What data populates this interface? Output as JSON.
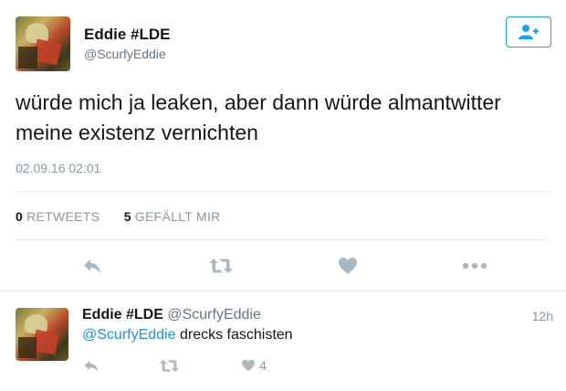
{
  "tweet": {
    "author_name": "Eddie #LDE",
    "author_handle": "@ScurfyEddie",
    "text_line1": "würde mich ja leaken, aber dann würde almantwitter",
    "text_line2": "meine existenz vernichten",
    "timestamp": "02.09.16 02:01",
    "retweets_count": "0",
    "retweets_label": "RETWEETS",
    "likes_count": "5",
    "likes_label": "GEFÄLLT MIR"
  },
  "follow_button": {
    "icon": "add-user-icon",
    "accent": "#1da1f2"
  },
  "actions": [
    "reply-icon",
    "retweet-icon",
    "like-icon",
    "more-icon"
  ],
  "reply": {
    "author_name": "Eddie #LDE",
    "author_handle": "@ScurfyEddie",
    "time": "12h",
    "mention": "@ScurfyEddie",
    "text": " drecks faschisten",
    "like_count": "4"
  },
  "colors": {
    "link": "#1b95e0",
    "muted": "#8899a6",
    "icon": "#aab8c2"
  }
}
